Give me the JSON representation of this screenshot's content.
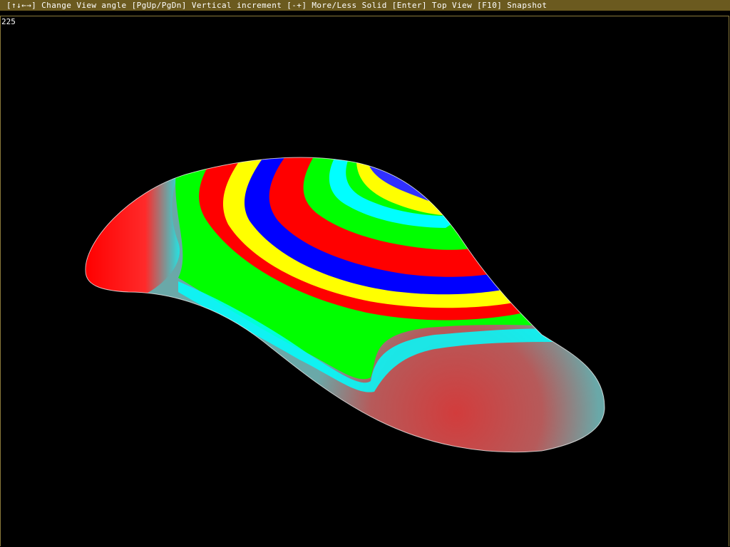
{
  "hint_bar": {
    "text": "[↑↓←→] Change View angle [PgUp/PgDn] Vertical increment [-+] More/Less Solid [Enter] Top View [F10] Snapshot"
  },
  "viewport": {
    "angle_readout": "225"
  },
  "colors": {
    "hint_bar_bg": "#6b5a1f",
    "red": "#ff0000",
    "yellow": "#ffff00",
    "green": "#00ff00",
    "cyan": "#00ffff",
    "blue": "#0000ff",
    "background": "#000000"
  }
}
